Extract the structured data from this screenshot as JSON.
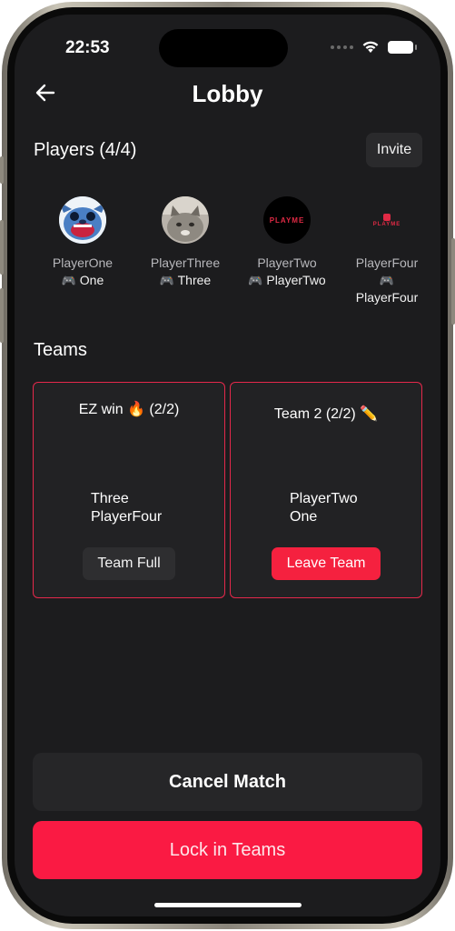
{
  "status": {
    "time": "22:53"
  },
  "header": {
    "title": "Lobby"
  },
  "players": {
    "title": "Players (4/4)",
    "invite_label": "Invite",
    "list": [
      {
        "name": "PlayerOne",
        "tag": "One",
        "avatar": "stitch-avatar"
      },
      {
        "name": "PlayerThree",
        "tag": "Three",
        "avatar": "cat-avatar"
      },
      {
        "name": "PlayerTwo",
        "tag": "PlayerTwo",
        "avatar": "playme-logo-avatar"
      },
      {
        "name": "PlayerFour",
        "tag": "PlayerFour",
        "avatar": "playme-logo-avatar"
      }
    ],
    "logo_text": "PLAYME"
  },
  "teams": {
    "title": "Teams",
    "cards": [
      {
        "name": "EZ win 🔥 (2/2)",
        "members": [
          "Three",
          "PlayerFour"
        ],
        "button_label": "Team Full"
      },
      {
        "name": "Team 2 (2/2) ✏️",
        "members": [
          "PlayerTwo",
          "One"
        ],
        "button_label": "Leave Team"
      }
    ]
  },
  "actions": {
    "cancel_label": "Cancel Match",
    "lock_label": "Lock in Teams"
  },
  "colors": {
    "accent": "#fa1a43",
    "background": "#1c1c1e",
    "card_border": "#e5284b"
  }
}
